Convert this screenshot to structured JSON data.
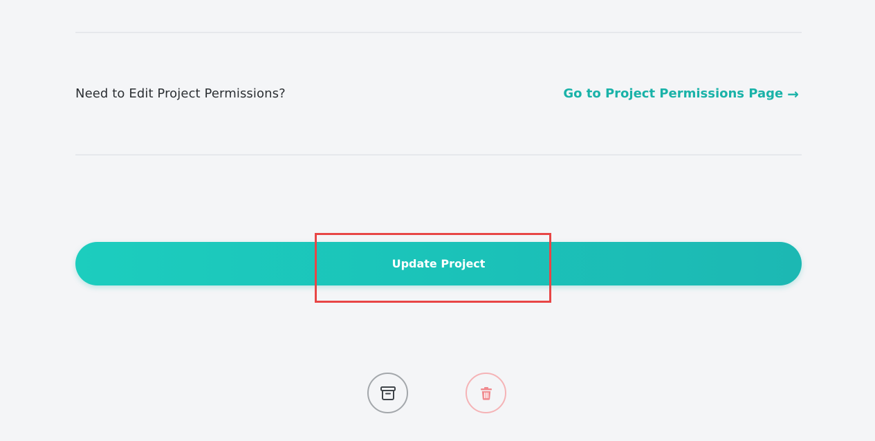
{
  "permissions": {
    "question": "Need to Edit Project Permissions?",
    "link_label": "Go to Project Permissions Page",
    "link_arrow": "→",
    "icon": "arrow-right-icon"
  },
  "actions": {
    "update_label": "Update Project",
    "archive_icon": "archive-icon",
    "delete_icon": "trash-icon"
  },
  "colors": {
    "accent": "#19b2a8",
    "button_gradient_start": "#1ccdbe",
    "button_gradient_end": "#1cb8b3",
    "highlight": "#e84646",
    "delete": "#f08a8f",
    "archive": "#3f4449",
    "background": "#f4f5f7"
  }
}
